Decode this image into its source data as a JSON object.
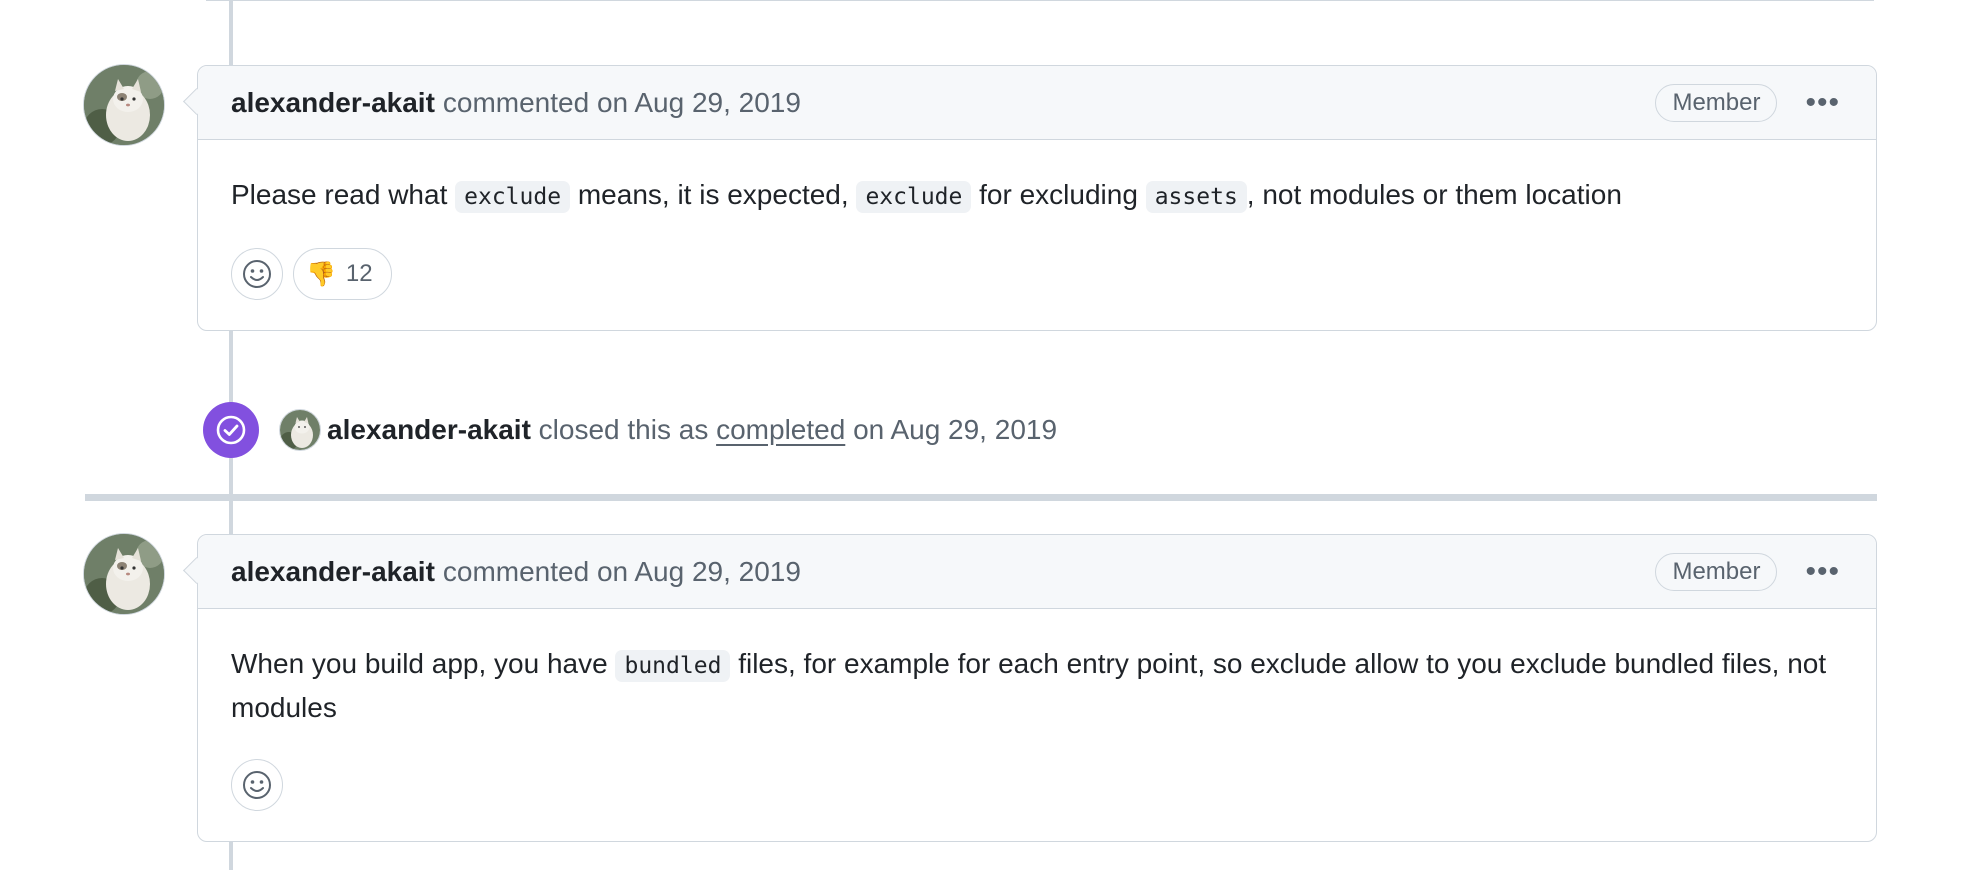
{
  "colors": {
    "accent_purple": "#8250df",
    "border": "#d0d7de",
    "muted_text": "#59636e",
    "header_bg": "#f6f8fa"
  },
  "comments": [
    {
      "author": "alexander-akait",
      "meta": "commented on Aug 29, 2019",
      "badge": "Member",
      "body": {
        "t1": "Please read what ",
        "c1": "exclude",
        "t2": " means, it is expected, ",
        "c2": "exclude",
        "t3": " for excluding ",
        "c3": "assets",
        "t4": ", not modules or them location"
      },
      "reactions": [
        {
          "emoji": "👎",
          "icon": "thumbs-down-icon",
          "count": "12"
        }
      ]
    },
    {
      "author": "alexander-akait",
      "meta": "commented on Aug 29, 2019",
      "badge": "Member",
      "body": {
        "t1": "When you build app, you have ",
        "c1": "bundled",
        "t2": " files, for example for each entry point, so exclude allow to you exclude bundled files, not modules"
      }
    }
  ],
  "event": {
    "author": "alexander-akait",
    "action": "closed this as",
    "link": "completed",
    "date": "on Aug 29, 2019",
    "icon": "check-circle-icon"
  }
}
